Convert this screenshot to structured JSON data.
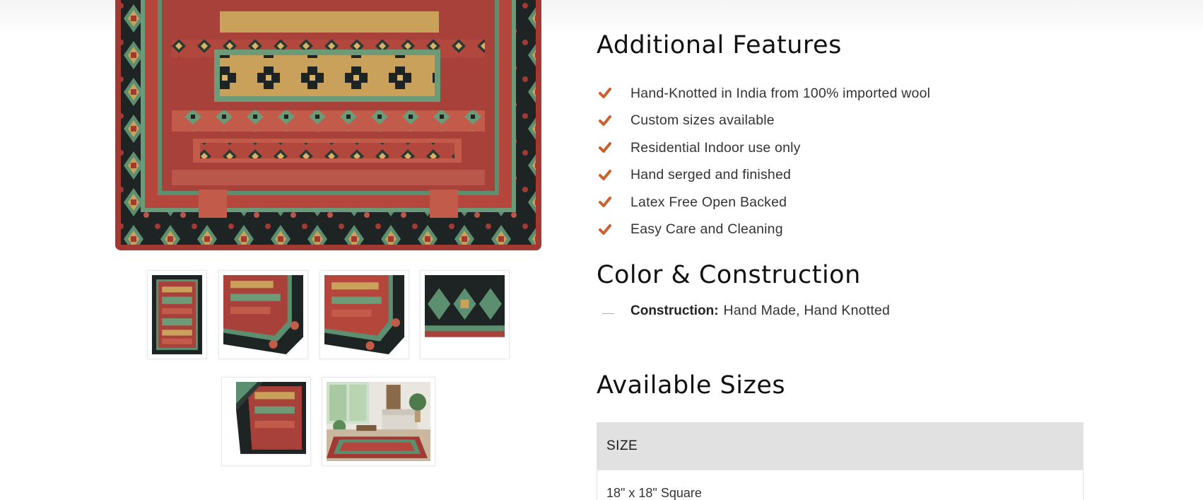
{
  "features": {
    "title": "Additional Features",
    "items": [
      "Hand-Knotted in India from 100% imported wool",
      "Custom sizes available",
      "Residential Indoor use only",
      "Hand serged and finished",
      "Latex Free Open Backed",
      "Easy Care and Cleaning"
    ],
    "check_icon": "check-icon",
    "accent_color": "#c8612e"
  },
  "color_construction": {
    "title": "Color & Construction",
    "construction_label": "Construction:",
    "construction_value": "Hand Made, Hand Knotted"
  },
  "sizes": {
    "title": "Available Sizes",
    "column_header": "SIZE",
    "rows": [
      "18\" x 18\" Square"
    ]
  },
  "gallery": {
    "thumbnails": [
      "rug-full-view",
      "rug-corner-closeup-1",
      "rug-corner-closeup-2",
      "rug-border-detail",
      "rug-folded-corner",
      "rug-room-scene"
    ]
  },
  "colors": {
    "rug_red": "#a23a33",
    "rug_dark": "#1d2423",
    "rug_green": "#5c8f70",
    "rug_gold": "#c9a15a"
  }
}
